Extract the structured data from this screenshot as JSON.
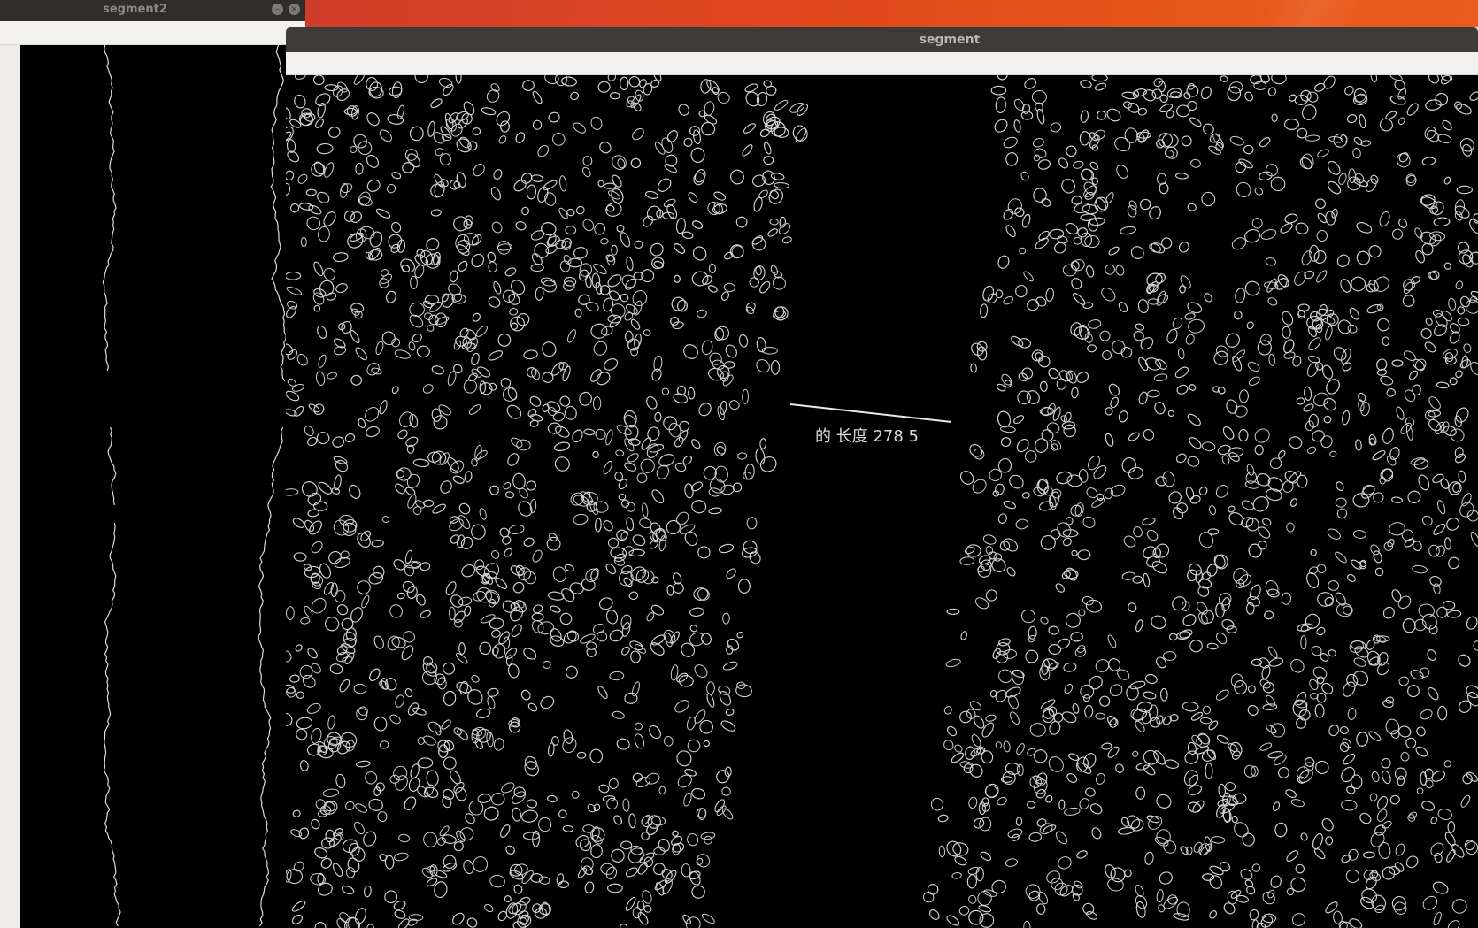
{
  "desktop": {
    "wallpaper_color": "#e0461f"
  },
  "windows": [
    {
      "id": "segment2",
      "title": "segment2",
      "buttons": {
        "minimize_icon": "minimize-icon",
        "close_icon": "close-icon",
        "minimize_glyph": "–",
        "close_glyph": "×"
      }
    },
    {
      "id": "segment",
      "title": "segment",
      "overlay_text": "的 长度 278 5"
    }
  ]
}
